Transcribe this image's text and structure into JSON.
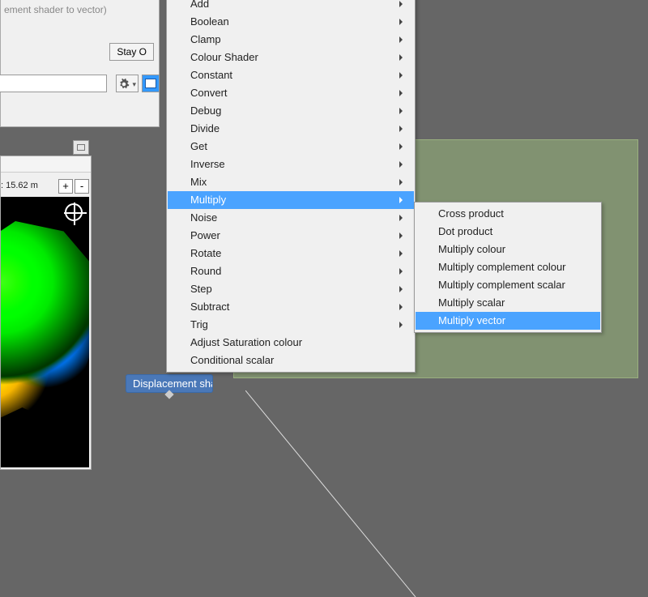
{
  "dialog": {
    "title_fragment": "ement shader to vector)",
    "stay_button": "Stay O",
    "search_value": "",
    "config_icon": "gear",
    "preview_toggle_icon": "image"
  },
  "preview": {
    "scale_label": ": 15.62 m",
    "plus": "+",
    "minus": "-"
  },
  "node_graph": {
    "displacement_node": "Displacement shader t..."
  },
  "menu": {
    "items": [
      {
        "label": "Add",
        "sub": true
      },
      {
        "label": "Boolean",
        "sub": true
      },
      {
        "label": "Clamp",
        "sub": true
      },
      {
        "label": "Colour Shader",
        "sub": true
      },
      {
        "label": "Constant",
        "sub": true
      },
      {
        "label": "Convert",
        "sub": true
      },
      {
        "label": "Debug",
        "sub": true
      },
      {
        "label": "Divide",
        "sub": true
      },
      {
        "label": "Get",
        "sub": true
      },
      {
        "label": "Inverse",
        "sub": true
      },
      {
        "label": "Mix",
        "sub": true
      },
      {
        "label": "Multiply",
        "sub": true,
        "hl": true
      },
      {
        "label": "Noise",
        "sub": true
      },
      {
        "label": "Power",
        "sub": true
      },
      {
        "label": "Rotate",
        "sub": true
      },
      {
        "label": "Round",
        "sub": true
      },
      {
        "label": "Step",
        "sub": true
      },
      {
        "label": "Subtract",
        "sub": true
      },
      {
        "label": "Trig",
        "sub": true
      },
      {
        "label": "Adjust Saturation colour",
        "sub": false
      },
      {
        "label": "Conditional scalar",
        "sub": false
      }
    ]
  },
  "submenu": {
    "items": [
      {
        "label": "Cross product"
      },
      {
        "label": "Dot product"
      },
      {
        "label": "Multiply colour"
      },
      {
        "label": "Multiply complement colour"
      },
      {
        "label": "Multiply complement scalar"
      },
      {
        "label": "Multiply scalar"
      },
      {
        "label": "Multiply vector",
        "hl": true
      }
    ]
  },
  "colors": {
    "menu_highlight": "#4aa3ff",
    "panel_bg": "#f0f0f0",
    "workspace_bg": "#666666",
    "group_node_bg": "rgba(144,170,120,0.65)"
  }
}
